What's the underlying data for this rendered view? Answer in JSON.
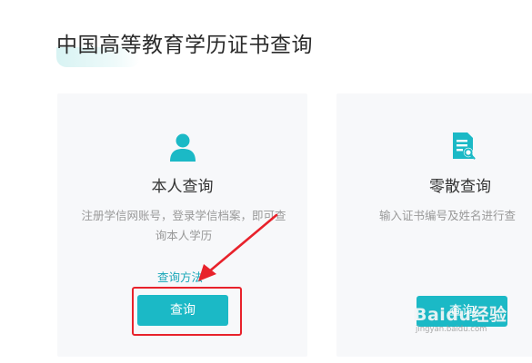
{
  "page": {
    "title": "中国高等教育学历证书查询"
  },
  "cards": {
    "self": {
      "icon": "user-icon",
      "title": "本人查询",
      "description": "注册学信网账号，登录学信档案，即可查询本人学历",
      "method_link": "查询方法",
      "button": "查询"
    },
    "scatter": {
      "icon": "document-search-icon",
      "title": "零散查询",
      "description": "输入证书编号及姓名进行查",
      "button": "查询"
    }
  },
  "watermark": {
    "logo": "Baidu经验",
    "url": "jingyan.baidu.com"
  },
  "colors": {
    "accent": "#1bb9c6",
    "link": "#1aa7b8",
    "annotation": "#e8222b",
    "card_bg": "#f7f8fa"
  }
}
